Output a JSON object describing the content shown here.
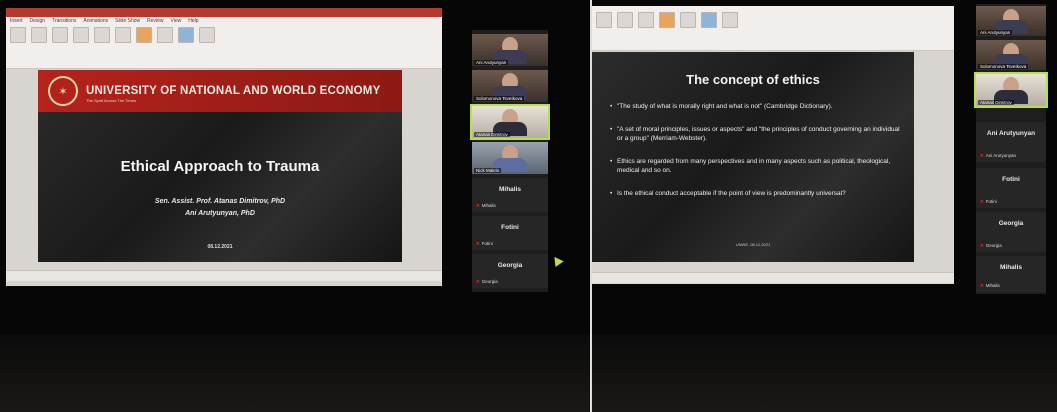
{
  "left": {
    "ribbon_tabs": [
      "Insert",
      "Design",
      "Transitions",
      "Animations",
      "Slide Show",
      "Review",
      "View",
      "Help"
    ],
    "slide": {
      "university": "UNIVERSITY OF NATIONAL AND WORLD ECONOMY",
      "university_sub": "The Spirit Across The Times",
      "title": "Ethical Approach to Trauma",
      "author1": "Sen. Assist. Prof. Atanas Dimitrov, PhD",
      "author2": "Ani Arutyunyan, PhD",
      "date": "08.12.2021"
    },
    "participants": [
      {
        "name": "Ani Arutyunyan",
        "type": "video"
      },
      {
        "name": "Solomonova Tsvetkova",
        "type": "video"
      },
      {
        "name": "Atanas Dimitrov",
        "type": "video",
        "active": true
      },
      {
        "name": "Nick Makris",
        "type": "video"
      },
      {
        "name": "Mihalis",
        "type": "audio"
      },
      {
        "name": "Fotini",
        "type": "audio"
      },
      {
        "name": "Georgia",
        "type": "audio"
      }
    ]
  },
  "right": {
    "slide": {
      "title": "The concept of ethics",
      "bullets": [
        "\"The study of what is morally right and what is not\" (Cambridge Dictionary).",
        "\"A set of moral principles, issues or aspects\" and \"the principles of conduct governing an individual or a group\" (Merriam-Webster).",
        "Ethics are regarded from many perspectives and in many aspects such as political, theological, medical and so on.",
        "Is the ethical conduct acceptable if the point of view is predominantly universal?"
      ],
      "date": "UNWE, 08.12.2021"
    },
    "participants": [
      {
        "name": "Ani Arutyunyan",
        "type": "video"
      },
      {
        "name": "Solomonova Tsvetkova",
        "type": "video"
      },
      {
        "name": "Atanas Dimitrov",
        "type": "video",
        "active": true
      },
      {
        "name": "Ani Arutyunyan",
        "type": "audio"
      },
      {
        "name": "Fotini",
        "type": "audio"
      },
      {
        "name": "Georgia",
        "type": "audio"
      },
      {
        "name": "Mihalis",
        "type": "audio"
      }
    ]
  }
}
